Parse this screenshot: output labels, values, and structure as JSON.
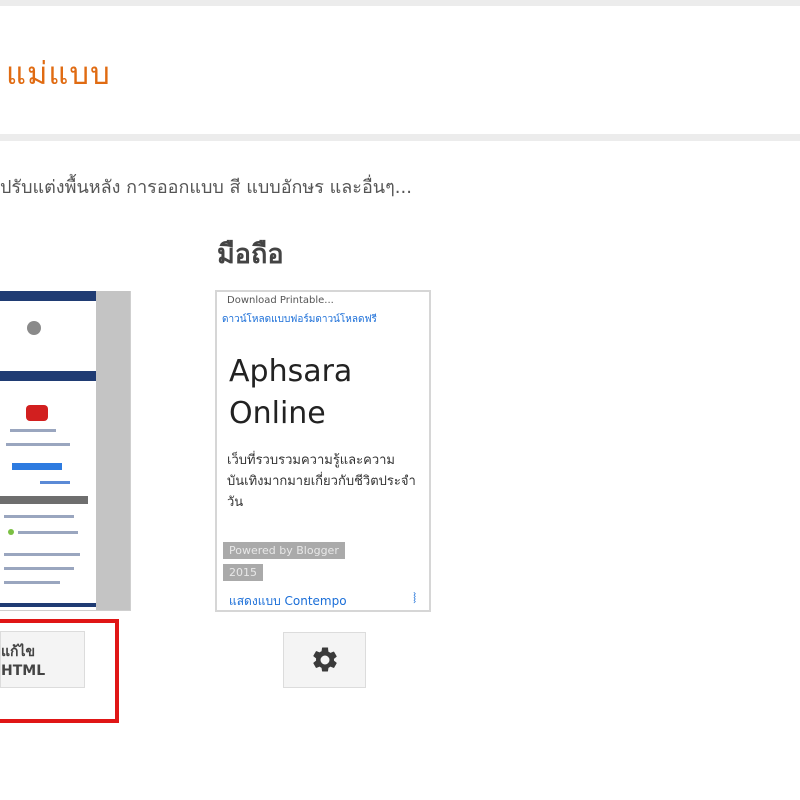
{
  "header": {
    "title": "แม่แบบ"
  },
  "description": "ปรับแต่งพื้นหลัง การออกแบบ สี แบบอักษร และอื่นๆ...",
  "mobile": {
    "heading": "มือถือ",
    "preview": {
      "header_text": "Download Printable...",
      "sublink": "ดาวน์โหลดแบบฟอร์มดาวน์โหลดฟรี",
      "title_line1": "Aphsara",
      "title_line2": "Online",
      "description": "เว็บที่รวบรวมความรู้และความบันเทิงมากมายเกี่ยวกับชีวิตประจำวัน",
      "meta_line1": "Powered by Blogger",
      "meta_line2": "2015",
      "link": "แสดงแบบ Contempo",
      "hook_icon": "curve-icon"
    },
    "gear_icon": "gear-icon"
  },
  "desktop": {
    "edit_html_label": "แก้ไข HTML"
  },
  "colors": {
    "title": "#e06b12",
    "highlight": "#e01616",
    "link": "#1a6ed8"
  }
}
